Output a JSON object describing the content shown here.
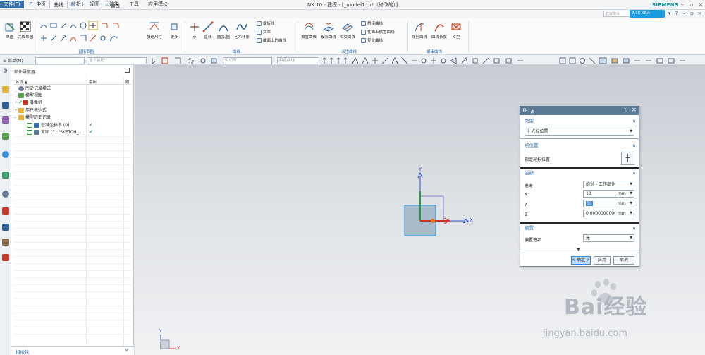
{
  "titlebar": {
    "app_logo": "NX",
    "title": "NX 10 - 建模 - [_model1.prt（修改的）]",
    "brand": "SIEMENS",
    "quick_access_icons": [
      "save-icon",
      "undo-icon",
      "redo-icon",
      "cut-icon",
      "copy-icon",
      "paste-icon",
      "add-icon",
      "command-finder-icon",
      "window-menu-icon"
    ],
    "window_label": "窗口",
    "minimize": "–",
    "maximize": "▫",
    "close": "×"
  },
  "menu": {
    "file": "文件(F)",
    "tabs": [
      "主页",
      "曲线",
      "分析",
      "视图",
      "渲染",
      "工具",
      "应用模块"
    ],
    "active_tab": "曲线",
    "command_search_placeholder": "查找命令",
    "net_speed": "7.1K KB/s"
  },
  "ribbon": {
    "sketch": "草图",
    "finish_sketch": "完成草图",
    "quick_dimension": "快速尺寸",
    "more": "更多",
    "point": "点",
    "line": "直线",
    "arc_circle": "圆弧/圆",
    "art_spline": "艺术样条",
    "spiral": "螺旋线",
    "text": "文本",
    "curve_on_surface": "曲面上的曲线",
    "offset_curve": "偏置曲线",
    "project_curve": "投影曲线",
    "intersect_curve": "相交曲线",
    "bridge_curve": "桥接曲线",
    "offset_on_face": "在面上偏置曲线",
    "composite_curve": "复合曲线",
    "trim_curve": "修剪曲线",
    "curve_length": "曲线长度",
    "x_form": "X 型",
    "groups": {
      "direct_sketch": "直接草图",
      "curve": "曲线",
      "derived_curve": "派生曲线",
      "edit_curve": "编辑曲线"
    }
  },
  "selection_bar": {
    "menu_label": "菜单(M)",
    "filter_placeholder": "",
    "assembly_placeholder": "整个装配",
    "snap1_placeholder": "相切面",
    "snap2_placeholder": "相连曲线"
  },
  "navigator": {
    "title": "部件导航器",
    "columns": [
      "名称",
      "最新",
      "附"
    ],
    "rows": [
      {
        "label": "历史记录模式",
        "latest": "",
        "indent": 0
      },
      {
        "label": "模型视图",
        "latest": "",
        "indent": 0
      },
      {
        "label": "摄像机",
        "latest": "",
        "indent": 0
      },
      {
        "label": "用户表达式",
        "latest": "",
        "indent": 0
      },
      {
        "label": "模型历史记录",
        "latest": "",
        "indent": 0
      },
      {
        "label": "基准坐标系 (0)",
        "latest": "✔",
        "indent": 1
      },
      {
        "label": "草图 (1) \"SKETCH_...",
        "latest": "✔",
        "indent": 1
      }
    ],
    "dependencies": "相依性"
  },
  "graphics": {
    "axis_x": "X",
    "axis_y": "Y",
    "axis_z": "Z",
    "triad_x": "X",
    "triad_y": "Y",
    "triad_z": "Z"
  },
  "dialog": {
    "title": "点",
    "type_section": "类型",
    "type_value": "光标位置",
    "point_location_section": "点位置",
    "specify_cursor": "指定光标位置",
    "coordinates_section": "坐标",
    "reference_label": "参考",
    "reference_value": "绝对 - 工作部件",
    "x_label": "X",
    "x_value": "10",
    "y_label": "Y",
    "y_value": "10",
    "z_label": "Z",
    "z_value": "0.0000000000",
    "unit": "mm",
    "offset_section": "偏置",
    "offset_option_label": "偏置选项",
    "offset_option_value": "无",
    "ok": "< 确定 >",
    "apply": "应用",
    "cancel": "取消"
  },
  "watermark": {
    "brand": "Bai经验",
    "url": "jingyan.baidu.com"
  }
}
